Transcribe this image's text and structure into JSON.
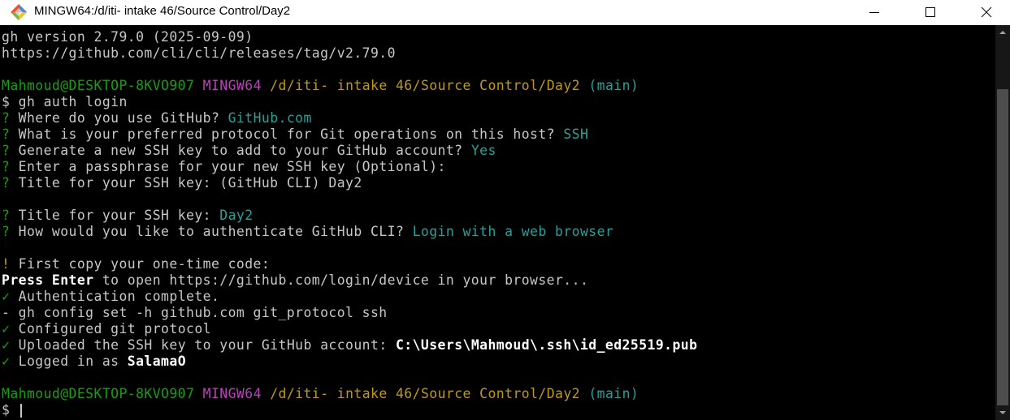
{
  "window": {
    "title": "MINGW64:/d/iti- intake 46/Source Control/Day2"
  },
  "terminal": {
    "version_line": "gh version 2.79.0 (2025-09-09)",
    "release_url": "https://github.com/cli/cli/releases/tag/v2.79.0",
    "prompt1": {
      "user_host": "Mahmoud@DESKTOP-8KVO907",
      "shell": "MINGW64",
      "path": "/d/iti- intake 46/Source Control/Day2",
      "branch": "(main)"
    },
    "command": "$ gh auth login",
    "questions": [
      {
        "mark": "?",
        "text": " Where do you use GitHub? ",
        "answer": "GitHub.com"
      },
      {
        "mark": "?",
        "text": " What is your preferred protocol for Git operations on this host? ",
        "answer": "SSH"
      },
      {
        "mark": "?",
        "text": " Generate a new SSH key to add to your GitHub account? ",
        "answer": "Yes"
      },
      {
        "mark": "?",
        "text": " Enter a passphrase for your new SSH key (Optional):",
        "answer": ""
      },
      {
        "mark": "?",
        "text": " Title for your SSH key: (GitHub CLI) Day2",
        "answer": ""
      },
      {
        "mark": "?",
        "text": " Title for your SSH key: ",
        "answer": "Day2"
      },
      {
        "mark": "?",
        "text": " How would you like to authenticate GitHub CLI? ",
        "answer": "Login with a web browser"
      }
    ],
    "copy_code": {
      "mark": "!",
      "text": " First copy your one-time code:"
    },
    "press_enter": {
      "bold": "Press Enter",
      "rest": " to open https://github.com/login/device in your browser..."
    },
    "auth_complete": {
      "mark": "✓",
      "text": " Authentication complete."
    },
    "config_set": "- gh config set -h github.com git_protocol ssh",
    "configured": {
      "mark": "✓",
      "text": " Configured git protocol"
    },
    "uploaded": {
      "mark": "✓",
      "text": " Uploaded the SSH key to your GitHub account: ",
      "path": "C:\\Users\\Mahmoud\\.ssh\\id_ed25519.pub"
    },
    "logged_in": {
      "mark": "✓",
      "text": " Logged in as ",
      "user": "SalamaO"
    },
    "prompt2": {
      "user_host": "Mahmoud@DESKTOP-8KVO907",
      "shell": "MINGW64",
      "path": "/d/iti- intake 46/Source Control/Day2",
      "branch": "(main)"
    },
    "final_prompt": "$"
  },
  "colors": {
    "background": "#000000",
    "text": "#c7c7c7",
    "green": "#13a10e",
    "magenta": "#bc3fbc",
    "yellow": "#c19c00",
    "answer": "#22a39a"
  },
  "icons": [
    "git-bash-icon",
    "minimize-icon",
    "maximize-icon",
    "close-icon",
    "scroll-up-icon",
    "scroll-down-icon"
  ]
}
